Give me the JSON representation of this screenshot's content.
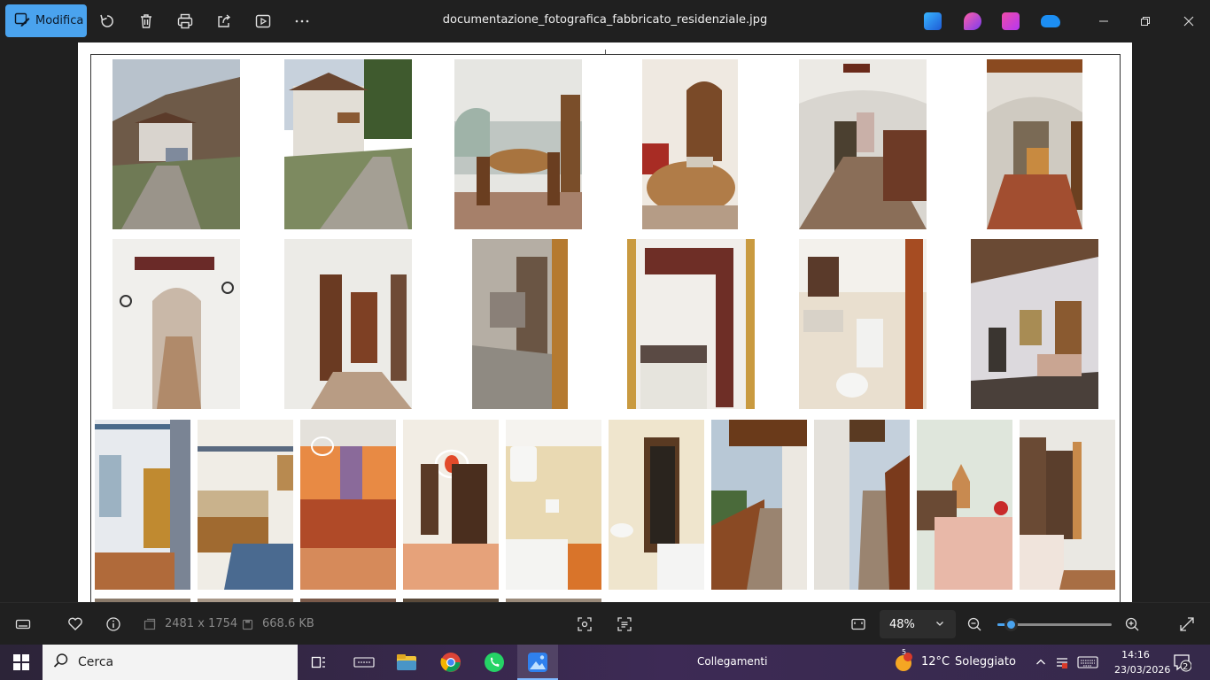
{
  "toolbar": {
    "edit_label": "Modifica",
    "file_title": "documentazione_fotografica_fabbricato_residenziale.jpg"
  },
  "status": {
    "dimensions": "2481 x 1754",
    "file_size": "668.6 KB",
    "zoom": "48%",
    "zoom_fraction": 0.12
  },
  "taskbar": {
    "search_placeholder": "Cerca",
    "links_label": "Collegamenti",
    "weather_temp": "12°C",
    "weather_desc": "Soleggiato",
    "weather_badge": "5",
    "time": "14:16",
    "date": "23/03/2026",
    "notification_count": "2"
  },
  "colors": {
    "accent": "#4aa3ee",
    "toolbar_bg": "#202020"
  }
}
